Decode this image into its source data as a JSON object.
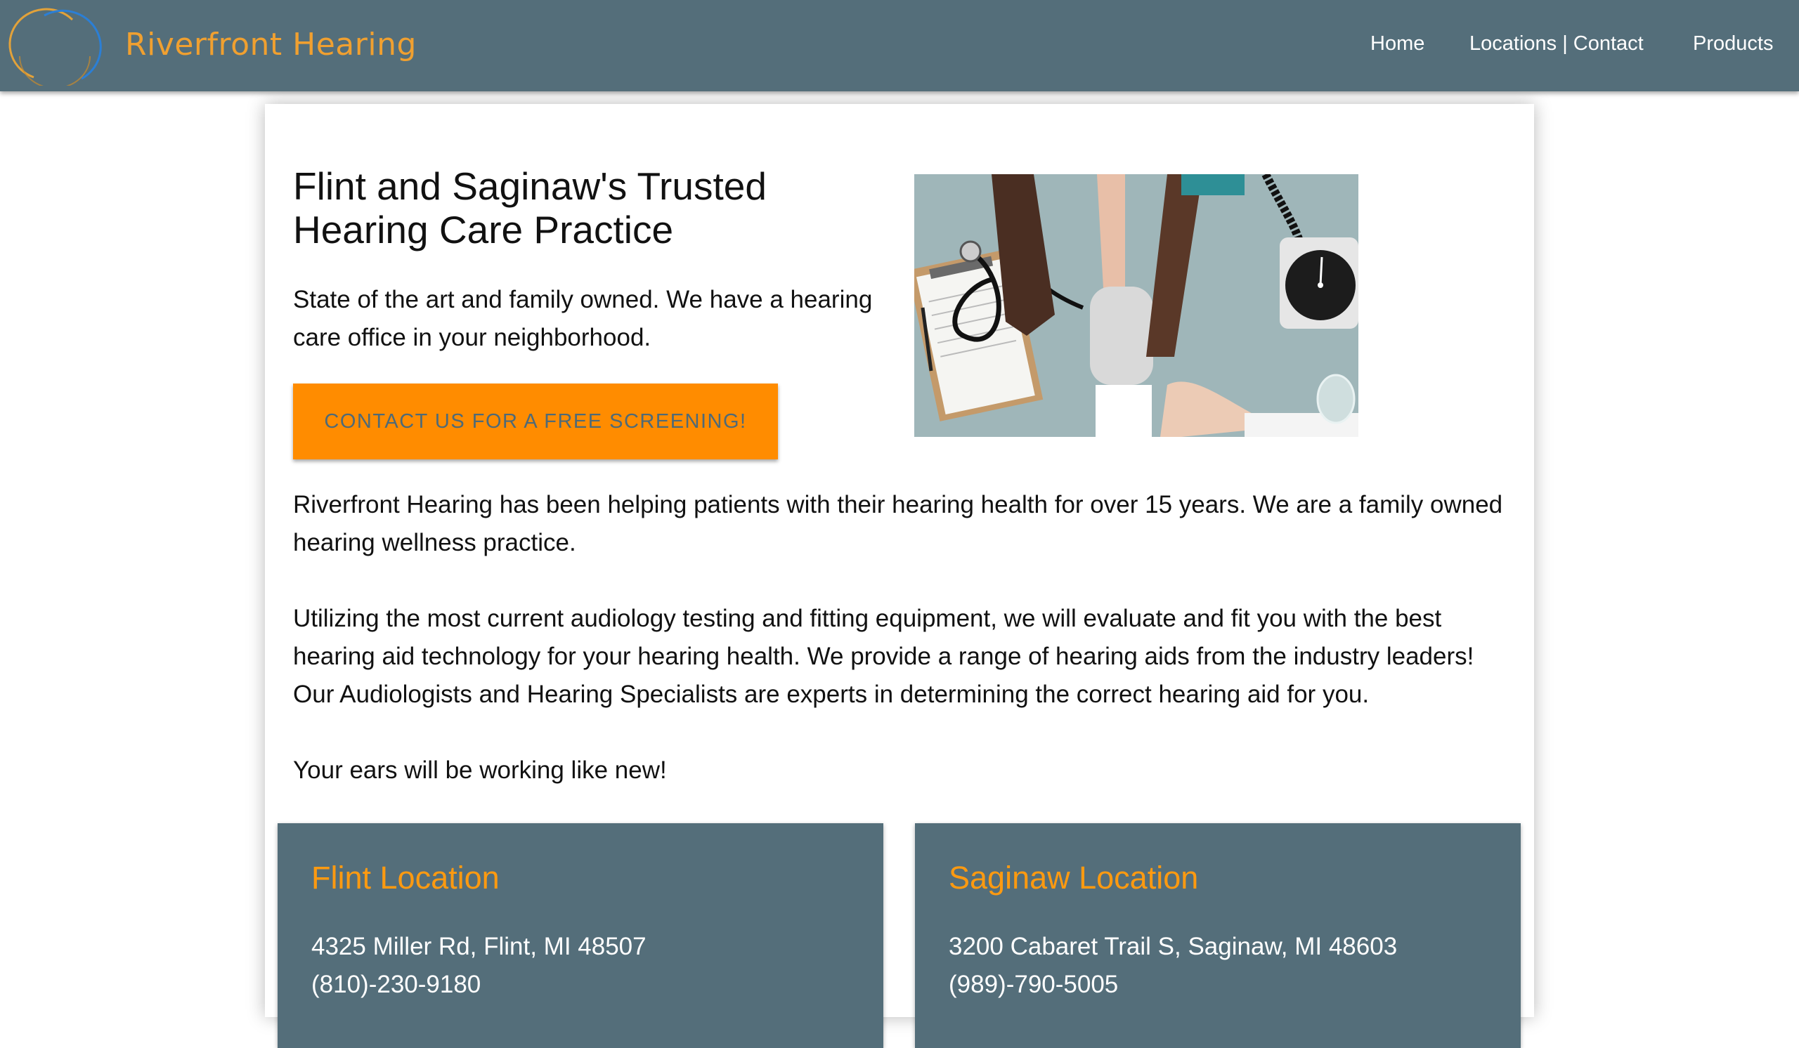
{
  "header": {
    "brand": "Riverfront Hearing",
    "nav": [
      {
        "label": "Home"
      },
      {
        "label": "Locations | Contact"
      },
      {
        "label": "Products"
      }
    ]
  },
  "hero": {
    "headline_line1": "Flint and Saginaw's Trusted",
    "headline_line2": "Hearing Care Practice",
    "subtext": "State of the art and family owned. We have a hearing care office in your neighborhood.",
    "cta_label": "CONTACT US FOR A FREE SCREENING!"
  },
  "body": {
    "paragraphs": [
      "Riverfront Hearing has been helping patients with their hearing health for over 15 years. We are a family owned hearing wellness practice.",
      "Utilizing the most current audiology testing and fitting equipment, we will evaluate and fit you with the best hearing aid technology for your hearing health. We provide a range of hearing aids from the industry leaders! Our Audiologists and Hearing Specialists are experts in determining the correct hearing aid for you.",
      "Your ears will be working like new!"
    ]
  },
  "locations": [
    {
      "title": "Flint Location",
      "address": "4325 Miller Rd, Flint, MI 48507",
      "phone": "(810)-230-9180"
    },
    {
      "title": "Saginaw Location",
      "address": "3200 Cabaret Trail S, Saginaw, MI 48603",
      "phone": "(989)-790-5005"
    }
  ],
  "colors": {
    "header_bg": "#546e7a",
    "brand_orange": "#ff8c00",
    "location_title": "#ff9a10"
  }
}
